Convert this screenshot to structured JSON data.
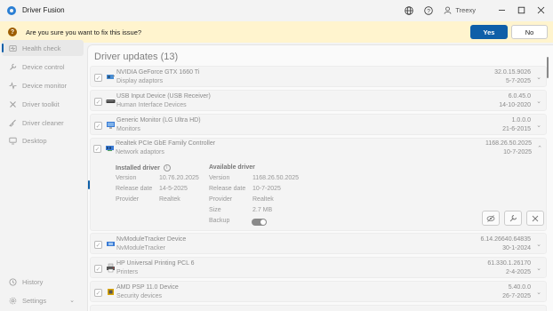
{
  "window": {
    "title": "Driver Fusion",
    "user": "Treexy"
  },
  "banner": {
    "message": "Are you sure you want to fix this issue?",
    "yes": "Yes",
    "no": "No"
  },
  "sidebar": {
    "items": [
      {
        "label": "Health check",
        "icon": "heart-icon",
        "active": true
      },
      {
        "label": "Device control",
        "icon": "wrench-icon"
      },
      {
        "label": "Device monitor",
        "icon": "pulse-icon"
      },
      {
        "label": "Driver toolkit",
        "icon": "tools-icon"
      },
      {
        "label": "Driver cleaner",
        "icon": "broom-icon"
      },
      {
        "label": "Desktop",
        "icon": "monitor-icon"
      }
    ],
    "history": "History",
    "settings": "Settings"
  },
  "main": {
    "title": "Driver updates (13)",
    "devices": [
      {
        "name": "NVIDIA GeForce GTX 1660 Ti",
        "category": "Display adaptors",
        "version": "32.0.15.9026",
        "date": "5-7-2025",
        "icon": "display-adapter-icon"
      },
      {
        "name": "USB Input Device (USB Receiver)",
        "category": "Human Interface Devices",
        "version": "6.0.45.0",
        "date": "14-10-2020",
        "icon": "keyboard-icon"
      },
      {
        "name": "Generic Monitor (LG Ultra HD)",
        "category": "Monitors",
        "version": "1.0.0.0",
        "date": "21-6-2015",
        "icon": "monitor-icon"
      },
      {
        "name": "Realtek PCIe GbE Family Controller",
        "category": "Network adaptors",
        "version": "1168.26.50.2025",
        "date": "10-7-2025",
        "icon": "network-icon"
      },
      {
        "name": "NvModuleTracker Device",
        "category": "NvModuleTracker",
        "version": "6.14.26640.64835",
        "date": "30-1-2024",
        "icon": "chip-icon"
      },
      {
        "name": "HP Universal Printing PCL 6",
        "category": "Printers",
        "version": "61.330.1.26170",
        "date": "2-4-2025",
        "icon": "printer-icon"
      },
      {
        "name": "AMD PSP 11.0 Device",
        "category": "Security devices",
        "version": "5.40.0.0",
        "date": "26-7-2025",
        "icon": "security-chip-icon"
      }
    ],
    "details": {
      "installed_title": "Installed driver",
      "available_title": "Available driver",
      "labels": {
        "version": "Version",
        "release_date": "Release date",
        "provider": "Provider",
        "size": "Size",
        "backup": "Backup"
      },
      "installed": {
        "version": "10.76.20.2025",
        "release_date": "14-5-2025",
        "provider": "Realtek"
      },
      "available": {
        "version": "1168.26.50.2025",
        "release_date": "10-7-2025",
        "provider": "Realtek",
        "size": "2.7 MB",
        "backup": true
      }
    }
  },
  "colors": {
    "accent": "#0e5fa8",
    "banner_bg": "#fff4ce",
    "warning": "#9d5d00"
  }
}
